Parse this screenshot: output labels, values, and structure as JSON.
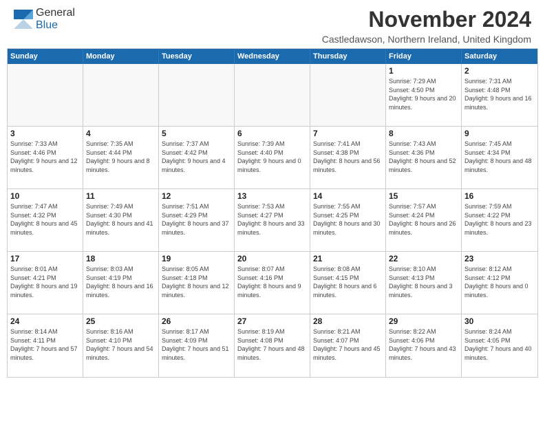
{
  "header": {
    "logo_general": "General",
    "logo_blue": "Blue",
    "month_title": "November 2024",
    "location": "Castledawson, Northern Ireland, United Kingdom"
  },
  "days_of_week": [
    "Sunday",
    "Monday",
    "Tuesday",
    "Wednesday",
    "Thursday",
    "Friday",
    "Saturday"
  ],
  "weeks": [
    [
      {
        "day": "",
        "info": ""
      },
      {
        "day": "",
        "info": ""
      },
      {
        "day": "",
        "info": ""
      },
      {
        "day": "",
        "info": ""
      },
      {
        "day": "",
        "info": ""
      },
      {
        "day": "1",
        "info": "Sunrise: 7:29 AM\nSunset: 4:50 PM\nDaylight: 9 hours and 20 minutes."
      },
      {
        "day": "2",
        "info": "Sunrise: 7:31 AM\nSunset: 4:48 PM\nDaylight: 9 hours and 16 minutes."
      }
    ],
    [
      {
        "day": "3",
        "info": "Sunrise: 7:33 AM\nSunset: 4:46 PM\nDaylight: 9 hours and 12 minutes."
      },
      {
        "day": "4",
        "info": "Sunrise: 7:35 AM\nSunset: 4:44 PM\nDaylight: 9 hours and 8 minutes."
      },
      {
        "day": "5",
        "info": "Sunrise: 7:37 AM\nSunset: 4:42 PM\nDaylight: 9 hours and 4 minutes."
      },
      {
        "day": "6",
        "info": "Sunrise: 7:39 AM\nSunset: 4:40 PM\nDaylight: 9 hours and 0 minutes."
      },
      {
        "day": "7",
        "info": "Sunrise: 7:41 AM\nSunset: 4:38 PM\nDaylight: 8 hours and 56 minutes."
      },
      {
        "day": "8",
        "info": "Sunrise: 7:43 AM\nSunset: 4:36 PM\nDaylight: 8 hours and 52 minutes."
      },
      {
        "day": "9",
        "info": "Sunrise: 7:45 AM\nSunset: 4:34 PM\nDaylight: 8 hours and 48 minutes."
      }
    ],
    [
      {
        "day": "10",
        "info": "Sunrise: 7:47 AM\nSunset: 4:32 PM\nDaylight: 8 hours and 45 minutes."
      },
      {
        "day": "11",
        "info": "Sunrise: 7:49 AM\nSunset: 4:30 PM\nDaylight: 8 hours and 41 minutes."
      },
      {
        "day": "12",
        "info": "Sunrise: 7:51 AM\nSunset: 4:29 PM\nDaylight: 8 hours and 37 minutes."
      },
      {
        "day": "13",
        "info": "Sunrise: 7:53 AM\nSunset: 4:27 PM\nDaylight: 8 hours and 33 minutes."
      },
      {
        "day": "14",
        "info": "Sunrise: 7:55 AM\nSunset: 4:25 PM\nDaylight: 8 hours and 30 minutes."
      },
      {
        "day": "15",
        "info": "Sunrise: 7:57 AM\nSunset: 4:24 PM\nDaylight: 8 hours and 26 minutes."
      },
      {
        "day": "16",
        "info": "Sunrise: 7:59 AM\nSunset: 4:22 PM\nDaylight: 8 hours and 23 minutes."
      }
    ],
    [
      {
        "day": "17",
        "info": "Sunrise: 8:01 AM\nSunset: 4:21 PM\nDaylight: 8 hours and 19 minutes."
      },
      {
        "day": "18",
        "info": "Sunrise: 8:03 AM\nSunset: 4:19 PM\nDaylight: 8 hours and 16 minutes."
      },
      {
        "day": "19",
        "info": "Sunrise: 8:05 AM\nSunset: 4:18 PM\nDaylight: 8 hours and 12 minutes."
      },
      {
        "day": "20",
        "info": "Sunrise: 8:07 AM\nSunset: 4:16 PM\nDaylight: 8 hours and 9 minutes."
      },
      {
        "day": "21",
        "info": "Sunrise: 8:08 AM\nSunset: 4:15 PM\nDaylight: 8 hours and 6 minutes."
      },
      {
        "day": "22",
        "info": "Sunrise: 8:10 AM\nSunset: 4:13 PM\nDaylight: 8 hours and 3 minutes."
      },
      {
        "day": "23",
        "info": "Sunrise: 8:12 AM\nSunset: 4:12 PM\nDaylight: 8 hours and 0 minutes."
      }
    ],
    [
      {
        "day": "24",
        "info": "Sunrise: 8:14 AM\nSunset: 4:11 PM\nDaylight: 7 hours and 57 minutes."
      },
      {
        "day": "25",
        "info": "Sunrise: 8:16 AM\nSunset: 4:10 PM\nDaylight: 7 hours and 54 minutes."
      },
      {
        "day": "26",
        "info": "Sunrise: 8:17 AM\nSunset: 4:09 PM\nDaylight: 7 hours and 51 minutes."
      },
      {
        "day": "27",
        "info": "Sunrise: 8:19 AM\nSunset: 4:08 PM\nDaylight: 7 hours and 48 minutes."
      },
      {
        "day": "28",
        "info": "Sunrise: 8:21 AM\nSunset: 4:07 PM\nDaylight: 7 hours and 45 minutes."
      },
      {
        "day": "29",
        "info": "Sunrise: 8:22 AM\nSunset: 4:06 PM\nDaylight: 7 hours and 43 minutes."
      },
      {
        "day": "30",
        "info": "Sunrise: 8:24 AM\nSunset: 4:05 PM\nDaylight: 7 hours and 40 minutes."
      }
    ]
  ]
}
